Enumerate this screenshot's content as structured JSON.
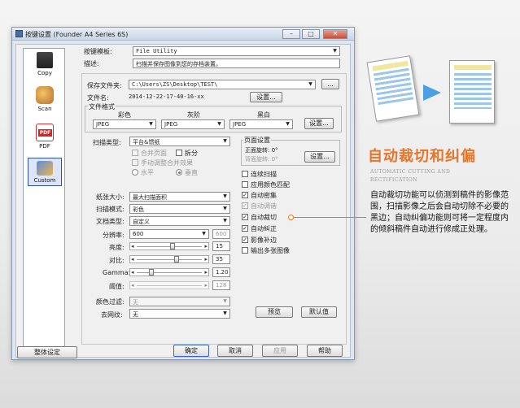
{
  "window": {
    "title": "按键设置 (Founder A4 Series 6S)",
    "minimize": "–",
    "maximize": "□",
    "close": "✕"
  },
  "modes": [
    {
      "label": "Copy",
      "icon": "printer-icon"
    },
    {
      "label": "Scan",
      "icon": "scan-icon"
    },
    {
      "label": "PDF",
      "icon": "pdf-icon"
    },
    {
      "label": "Custom",
      "icon": "custom-icon",
      "selected": true
    }
  ],
  "template": {
    "label": "按键模板:",
    "value": "File Utility"
  },
  "description": {
    "label": "描述:",
    "value": "扫描并保存图像到您的存档装置。"
  },
  "save_folder": {
    "label": "保存文件夹:",
    "value": "C:\\Users\\ZS\\Desktop\\TEST\\",
    "browse": "..."
  },
  "file_name": {
    "label": "文件名:",
    "value": "2014-12-22-17-40-16-xx",
    "settings": "设置..."
  },
  "file_format": {
    "label": "文件格式",
    "color_label": "彩色",
    "gray_label": "灰阶",
    "bw_label": "黑白",
    "color_value": "JPEG",
    "gray_value": "JPEG",
    "bw_value": "JPEG",
    "settings": "设置..."
  },
  "scan_type": {
    "label": "扫描类型:",
    "value": "平台&馈纸",
    "merge": "合并页面",
    "split": "拆分",
    "manual_merge": "手动调整合并效果",
    "horizontal": "水平",
    "vertical": "垂直"
  },
  "page_settings": {
    "label": "页面设置",
    "front_rotate": "正面旋转: 0°",
    "back_rotate": "背面旋转: 0°",
    "settings": "设置..."
  },
  "options": [
    {
      "label": "连续扫描",
      "checked": false
    },
    {
      "label": "应用颜色匹配",
      "checked": false
    },
    {
      "label": "自动密集",
      "checked": true
    },
    {
      "label": "自动调谐",
      "checked": true,
      "disabled": true
    },
    {
      "label": "自动裁切",
      "checked": true
    },
    {
      "label": "自动糾正",
      "checked": true
    },
    {
      "label": "影像补边",
      "checked": true
    },
    {
      "label": "输出多张图像",
      "checked": false
    }
  ],
  "paper_size": {
    "label": "纸张大小:",
    "value": "最大扫描面积"
  },
  "scan_mode": {
    "label": "扫描模式:",
    "value": "彩色"
  },
  "doc_type": {
    "label": "文档类型:",
    "value": "自定义"
  },
  "resolution": {
    "label": "分辨率:",
    "value": "600",
    "box": "600"
  },
  "brightness": {
    "label": "亮度:",
    "value": "15",
    "level": 0.55
  },
  "contrast": {
    "label": "对比:",
    "value": "35",
    "level": 0.62
  },
  "gamma": {
    "label": "Gamma:",
    "value": "1.20",
    "level": 0.2
  },
  "threshold": {
    "label": "阈值:",
    "value": "128",
    "level": 0.5
  },
  "color_filter": {
    "label": "颜色过滤:",
    "value": "无"
  },
  "descreen": {
    "label": "去网纹:",
    "value": "无"
  },
  "preview_button": "预览",
  "default_button": "默认值",
  "overall_settings": "整体设定",
  "ok": "确定",
  "cancel": "取消",
  "apply": "应用",
  "help": "帮助",
  "feature": {
    "title": "自动裁切和纠偏",
    "subtitle": "AUTOMATIC CUTTING AND RECTIFICATION",
    "text": "自动裁切功能可以侦测到稿件的影像范围，扫描影像之后会自动切除不必要的黑边；自动纠偏功能则可将一定程度内的倾斜稿件自动进行修成正处理。"
  },
  "colors": {
    "accent": "#e8742a",
    "window_blue": "#dfe6ef",
    "doc_blue": "#9cc6ea",
    "doc_yellow": "#f2e7a0"
  }
}
